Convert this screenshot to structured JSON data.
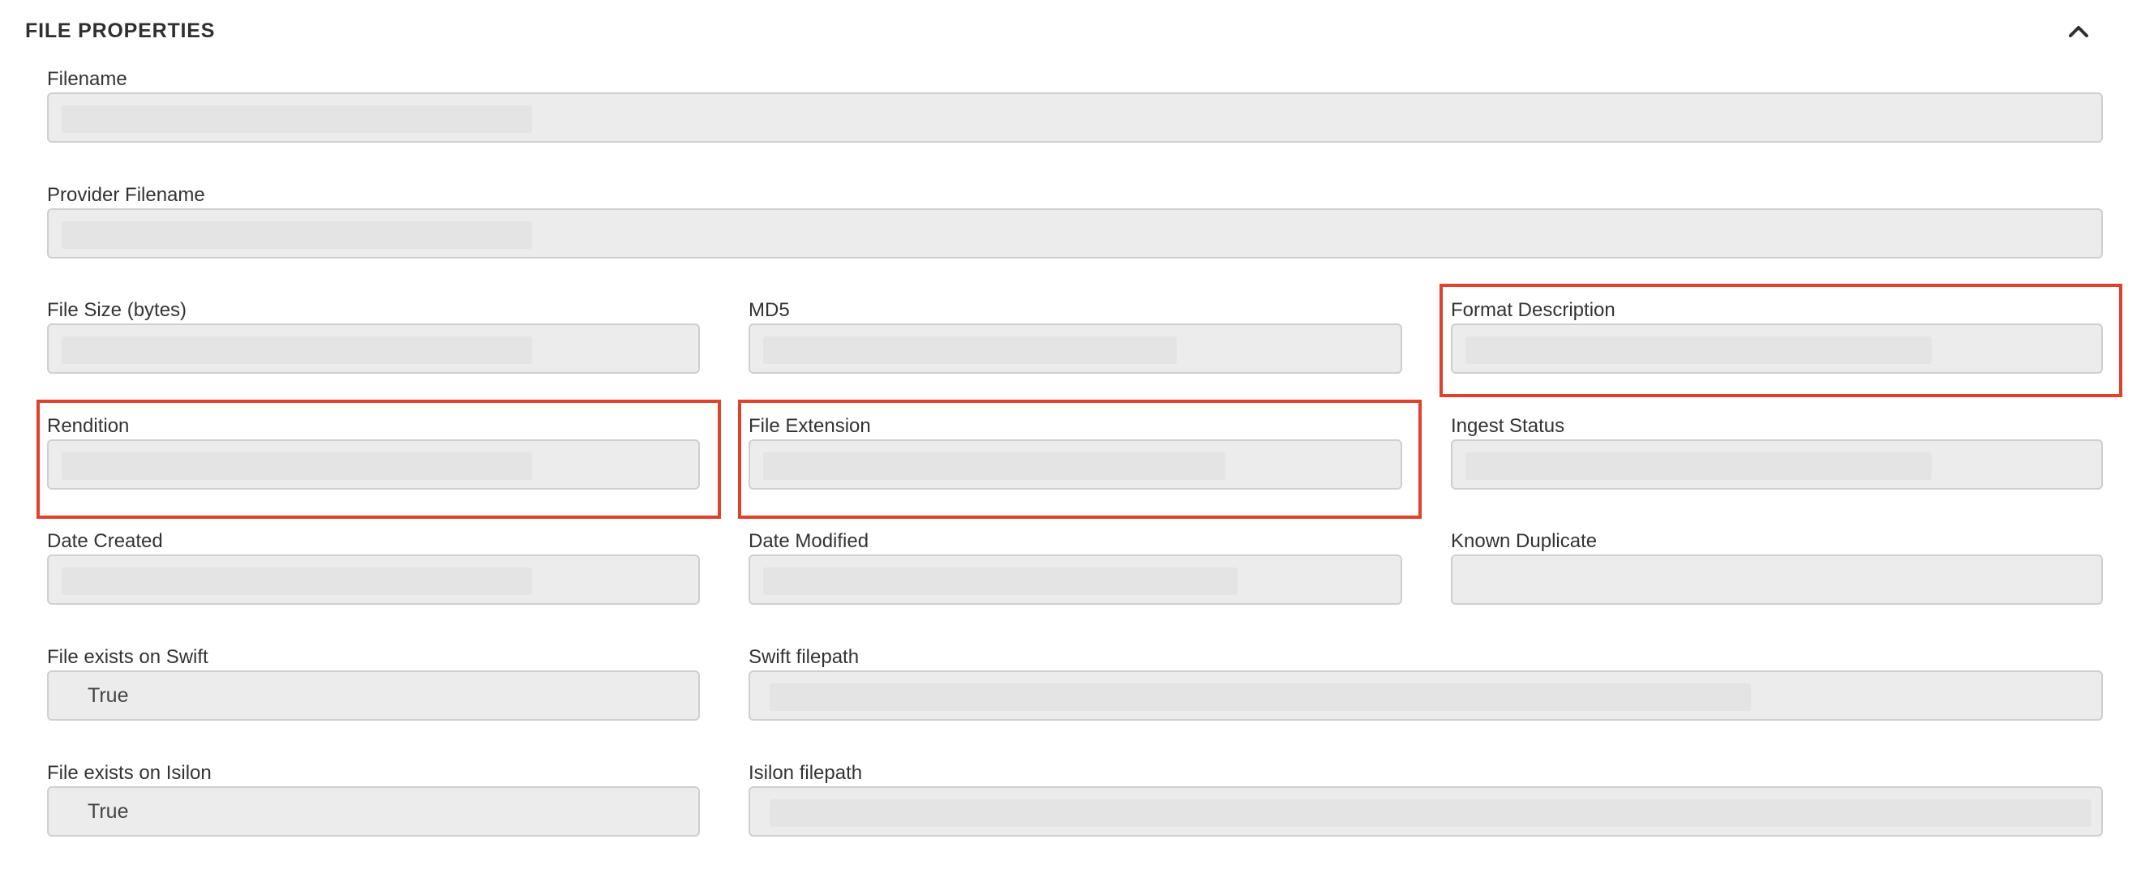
{
  "section": {
    "title": "FILE PROPERTIES",
    "toggle_icon": "chevron-up-icon"
  },
  "fields": {
    "filename": {
      "label": "Filename",
      "value": ""
    },
    "provider_filename": {
      "label": "Provider Filename",
      "value": ""
    },
    "file_size": {
      "label": "File Size (bytes)",
      "value": ""
    },
    "md5": {
      "label": "MD5",
      "value": ""
    },
    "format_description": {
      "label": "Format Description",
      "value": ""
    },
    "rendition": {
      "label": "Rendition",
      "value": ""
    },
    "file_extension": {
      "label": "File Extension",
      "value": ""
    },
    "ingest_status": {
      "label": "Ingest Status",
      "value": ""
    },
    "date_created": {
      "label": "Date Created",
      "value": ""
    },
    "date_modified": {
      "label": "Date Modified",
      "value": ""
    },
    "known_duplicate": {
      "label": "Known Duplicate",
      "value": ""
    },
    "file_exists_swift": {
      "label": "File exists on Swift",
      "value": "True"
    },
    "swift_filepath": {
      "label": "Swift filepath",
      "value": ""
    },
    "file_exists_isilon": {
      "label": "File exists on Isilon",
      "value": "True"
    },
    "isilon_filepath": {
      "label": "Isilon filepath",
      "value": ""
    }
  },
  "colors": {
    "highlight": "#e0412b",
    "input_background": "#ececec",
    "input_border": "#cfcfcf"
  }
}
